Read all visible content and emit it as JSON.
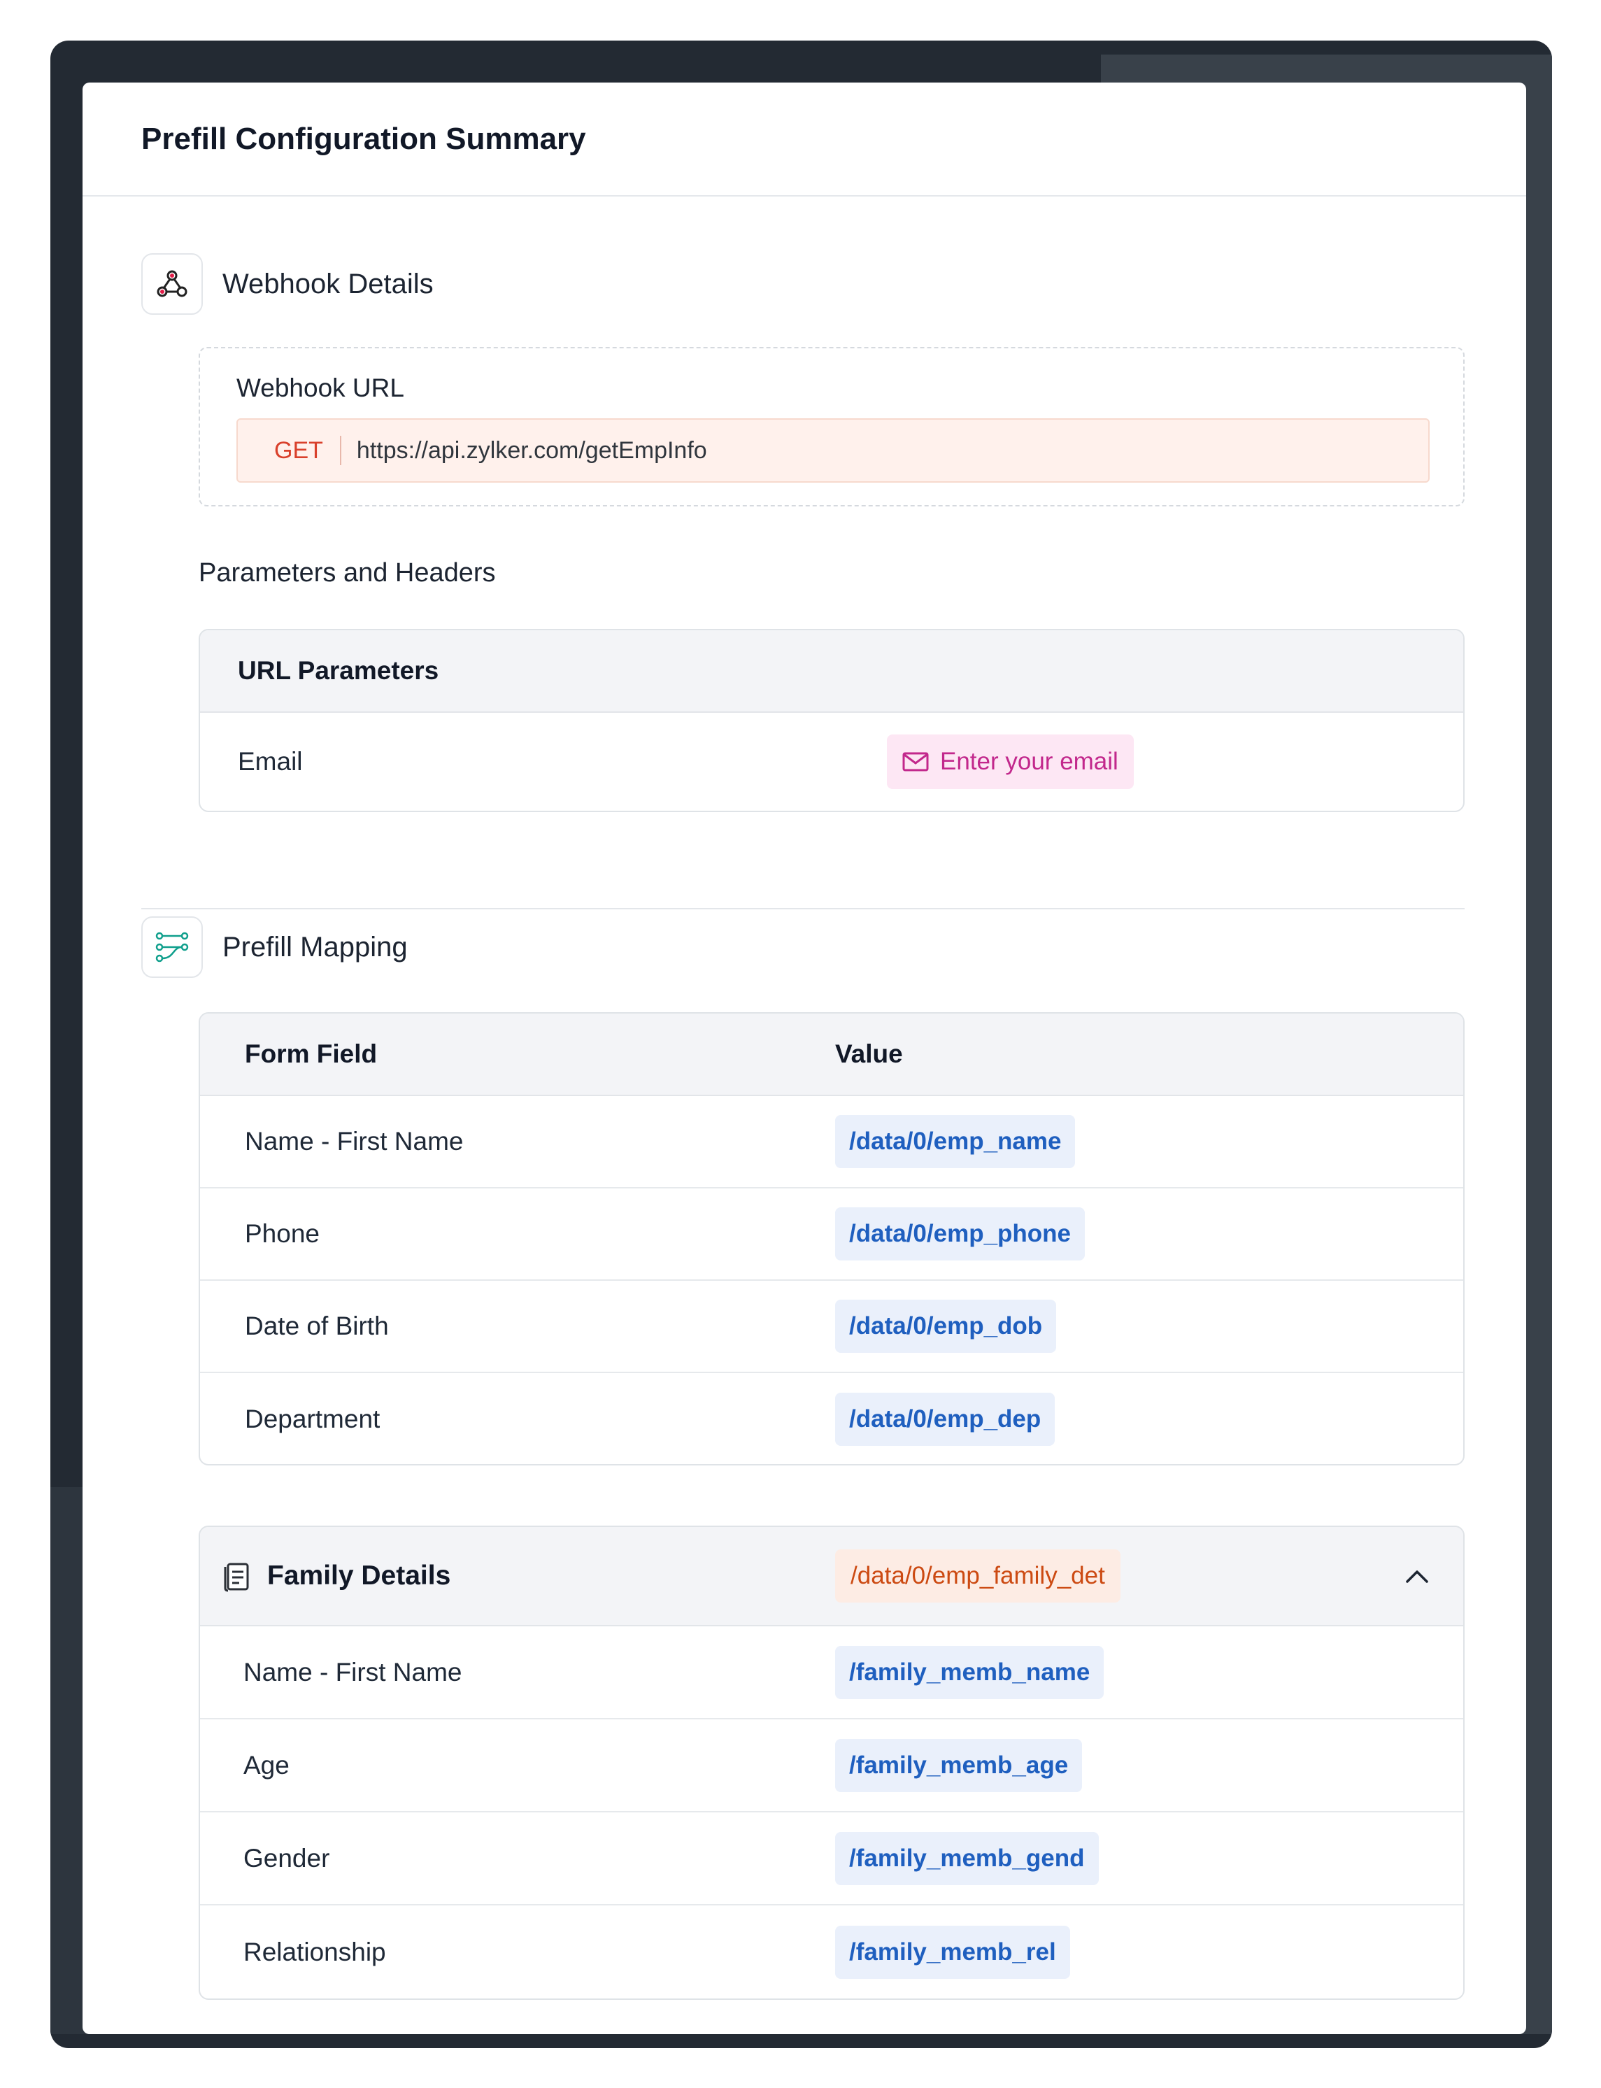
{
  "modal": {
    "title": "Prefill Configuration Summary"
  },
  "webhook": {
    "section_title": "Webhook Details",
    "url_label": "Webhook URL",
    "method": "GET",
    "url": "https://api.zylker.com/getEmpInfo",
    "params_title": "Parameters and Headers",
    "url_params_header": "URL Parameters",
    "params": [
      {
        "name": "Email",
        "value": "Enter your email"
      }
    ]
  },
  "mapping": {
    "section_title": "Prefill Mapping",
    "col_field": "Form Field",
    "col_value": "Value",
    "rows": [
      {
        "field": "Name - First Name",
        "value": "/data/0/emp_name"
      },
      {
        "field": "Phone",
        "value": "/data/0/emp_phone"
      },
      {
        "field": "Date of Birth",
        "value": "/data/0/emp_dob"
      },
      {
        "field": "Department",
        "value": "/data/0/emp_dep"
      }
    ]
  },
  "family": {
    "title": "Family Details",
    "path": "/data/0/emp_family_det",
    "rows": [
      {
        "field": "Name - First Name",
        "value": "/family_memb_name"
      },
      {
        "field": "Age",
        "value": "/family_memb_age"
      },
      {
        "field": "Gender",
        "value": "/family_memb_gend"
      },
      {
        "field": "Relationship",
        "value": "/family_memb_rel"
      }
    ]
  },
  "icons": {
    "webhook": "webhook-icon",
    "mapping": "mapping-icon",
    "email": "mail-icon",
    "family": "document-icon",
    "collapse": "chevron-up-icon"
  },
  "colors": {
    "method": "#d9402b",
    "value_chip_text": "#1f5fbf",
    "email_chip_text": "#c2288c",
    "family_path_text": "#cc4a12"
  }
}
